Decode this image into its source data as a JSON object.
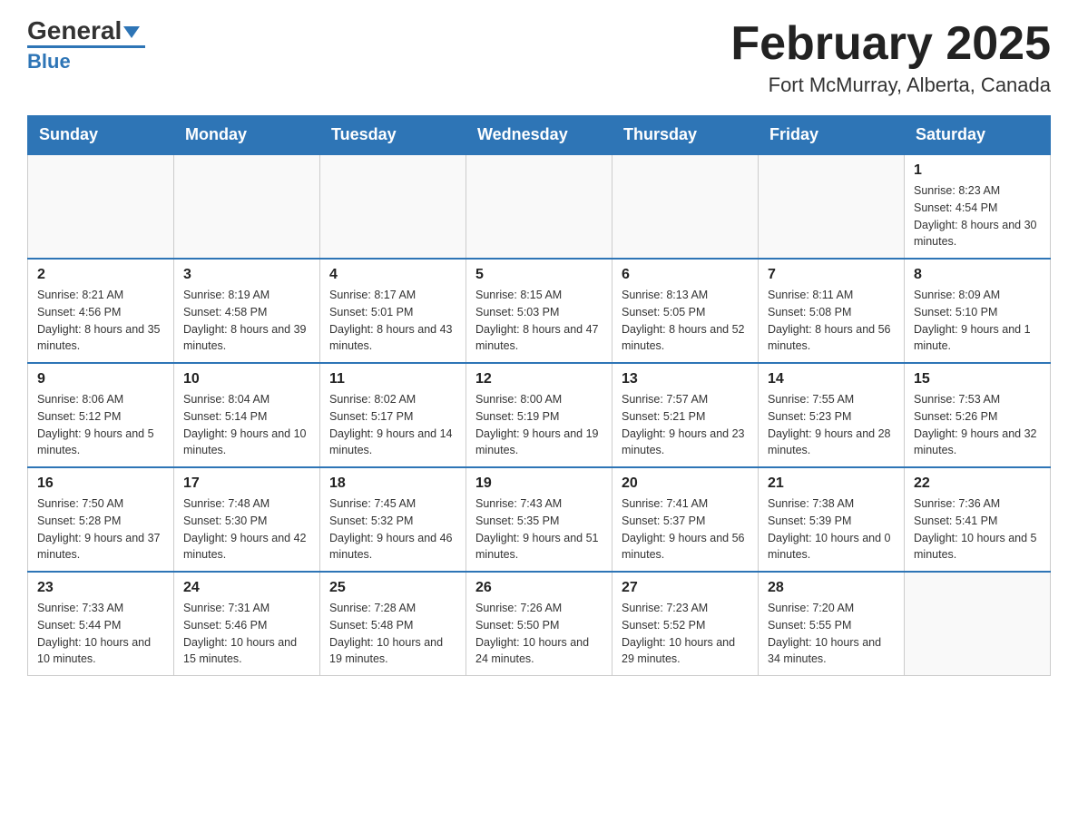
{
  "header": {
    "logo_main": "General",
    "logo_sub": "Blue",
    "month_title": "February 2025",
    "location": "Fort McMurray, Alberta, Canada"
  },
  "days_of_week": [
    "Sunday",
    "Monday",
    "Tuesday",
    "Wednesday",
    "Thursday",
    "Friday",
    "Saturday"
  ],
  "weeks": [
    [
      {
        "day": "",
        "info": ""
      },
      {
        "day": "",
        "info": ""
      },
      {
        "day": "",
        "info": ""
      },
      {
        "day": "",
        "info": ""
      },
      {
        "day": "",
        "info": ""
      },
      {
        "day": "",
        "info": ""
      },
      {
        "day": "1",
        "info": "Sunrise: 8:23 AM\nSunset: 4:54 PM\nDaylight: 8 hours and 30 minutes."
      }
    ],
    [
      {
        "day": "2",
        "info": "Sunrise: 8:21 AM\nSunset: 4:56 PM\nDaylight: 8 hours and 35 minutes."
      },
      {
        "day": "3",
        "info": "Sunrise: 8:19 AM\nSunset: 4:58 PM\nDaylight: 8 hours and 39 minutes."
      },
      {
        "day": "4",
        "info": "Sunrise: 8:17 AM\nSunset: 5:01 PM\nDaylight: 8 hours and 43 minutes."
      },
      {
        "day": "5",
        "info": "Sunrise: 8:15 AM\nSunset: 5:03 PM\nDaylight: 8 hours and 47 minutes."
      },
      {
        "day": "6",
        "info": "Sunrise: 8:13 AM\nSunset: 5:05 PM\nDaylight: 8 hours and 52 minutes."
      },
      {
        "day": "7",
        "info": "Sunrise: 8:11 AM\nSunset: 5:08 PM\nDaylight: 8 hours and 56 minutes."
      },
      {
        "day": "8",
        "info": "Sunrise: 8:09 AM\nSunset: 5:10 PM\nDaylight: 9 hours and 1 minute."
      }
    ],
    [
      {
        "day": "9",
        "info": "Sunrise: 8:06 AM\nSunset: 5:12 PM\nDaylight: 9 hours and 5 minutes."
      },
      {
        "day": "10",
        "info": "Sunrise: 8:04 AM\nSunset: 5:14 PM\nDaylight: 9 hours and 10 minutes."
      },
      {
        "day": "11",
        "info": "Sunrise: 8:02 AM\nSunset: 5:17 PM\nDaylight: 9 hours and 14 minutes."
      },
      {
        "day": "12",
        "info": "Sunrise: 8:00 AM\nSunset: 5:19 PM\nDaylight: 9 hours and 19 minutes."
      },
      {
        "day": "13",
        "info": "Sunrise: 7:57 AM\nSunset: 5:21 PM\nDaylight: 9 hours and 23 minutes."
      },
      {
        "day": "14",
        "info": "Sunrise: 7:55 AM\nSunset: 5:23 PM\nDaylight: 9 hours and 28 minutes."
      },
      {
        "day": "15",
        "info": "Sunrise: 7:53 AM\nSunset: 5:26 PM\nDaylight: 9 hours and 32 minutes."
      }
    ],
    [
      {
        "day": "16",
        "info": "Sunrise: 7:50 AM\nSunset: 5:28 PM\nDaylight: 9 hours and 37 minutes."
      },
      {
        "day": "17",
        "info": "Sunrise: 7:48 AM\nSunset: 5:30 PM\nDaylight: 9 hours and 42 minutes."
      },
      {
        "day": "18",
        "info": "Sunrise: 7:45 AM\nSunset: 5:32 PM\nDaylight: 9 hours and 46 minutes."
      },
      {
        "day": "19",
        "info": "Sunrise: 7:43 AM\nSunset: 5:35 PM\nDaylight: 9 hours and 51 minutes."
      },
      {
        "day": "20",
        "info": "Sunrise: 7:41 AM\nSunset: 5:37 PM\nDaylight: 9 hours and 56 minutes."
      },
      {
        "day": "21",
        "info": "Sunrise: 7:38 AM\nSunset: 5:39 PM\nDaylight: 10 hours and 0 minutes."
      },
      {
        "day": "22",
        "info": "Sunrise: 7:36 AM\nSunset: 5:41 PM\nDaylight: 10 hours and 5 minutes."
      }
    ],
    [
      {
        "day": "23",
        "info": "Sunrise: 7:33 AM\nSunset: 5:44 PM\nDaylight: 10 hours and 10 minutes."
      },
      {
        "day": "24",
        "info": "Sunrise: 7:31 AM\nSunset: 5:46 PM\nDaylight: 10 hours and 15 minutes."
      },
      {
        "day": "25",
        "info": "Sunrise: 7:28 AM\nSunset: 5:48 PM\nDaylight: 10 hours and 19 minutes."
      },
      {
        "day": "26",
        "info": "Sunrise: 7:26 AM\nSunset: 5:50 PM\nDaylight: 10 hours and 24 minutes."
      },
      {
        "day": "27",
        "info": "Sunrise: 7:23 AM\nSunset: 5:52 PM\nDaylight: 10 hours and 29 minutes."
      },
      {
        "day": "28",
        "info": "Sunrise: 7:20 AM\nSunset: 5:55 PM\nDaylight: 10 hours and 34 minutes."
      },
      {
        "day": "",
        "info": ""
      }
    ]
  ]
}
